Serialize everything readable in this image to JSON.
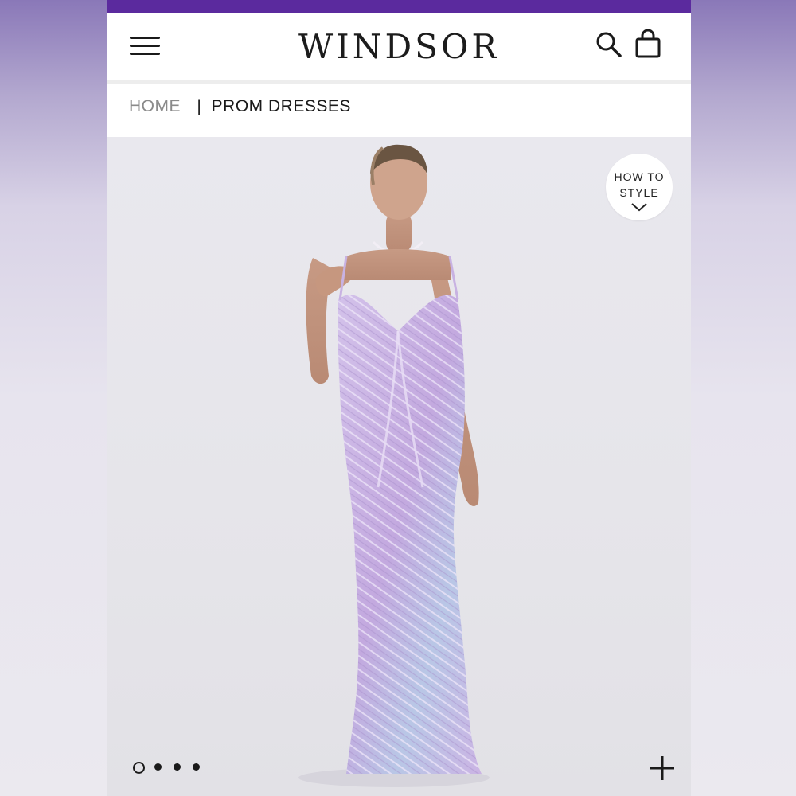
{
  "promo": {
    "text": ""
  },
  "header": {
    "menu_icon": "hamburger-menu-icon",
    "logo": "WINDSOR",
    "search_icon": "search-icon",
    "bag_icon": "shopping-bag-icon"
  },
  "breadcrumb": {
    "home": "HOME",
    "separator": "|",
    "current": "PROM DRESSES"
  },
  "product_image": {
    "style_badge": {
      "line1": "HOW TO",
      "line2": "STYLE",
      "icon": "chevron-down-icon"
    },
    "carousel": {
      "total": 4,
      "active": 1
    },
    "zoom_icon": "plus-icon"
  },
  "colors": {
    "promo_bar": "#5b2a9e",
    "text": "#1a1a1a",
    "breadcrumb_home": "#8a8a8a",
    "dress_lavender": "#c7b0e2",
    "page_background": "#e9e8ee"
  }
}
